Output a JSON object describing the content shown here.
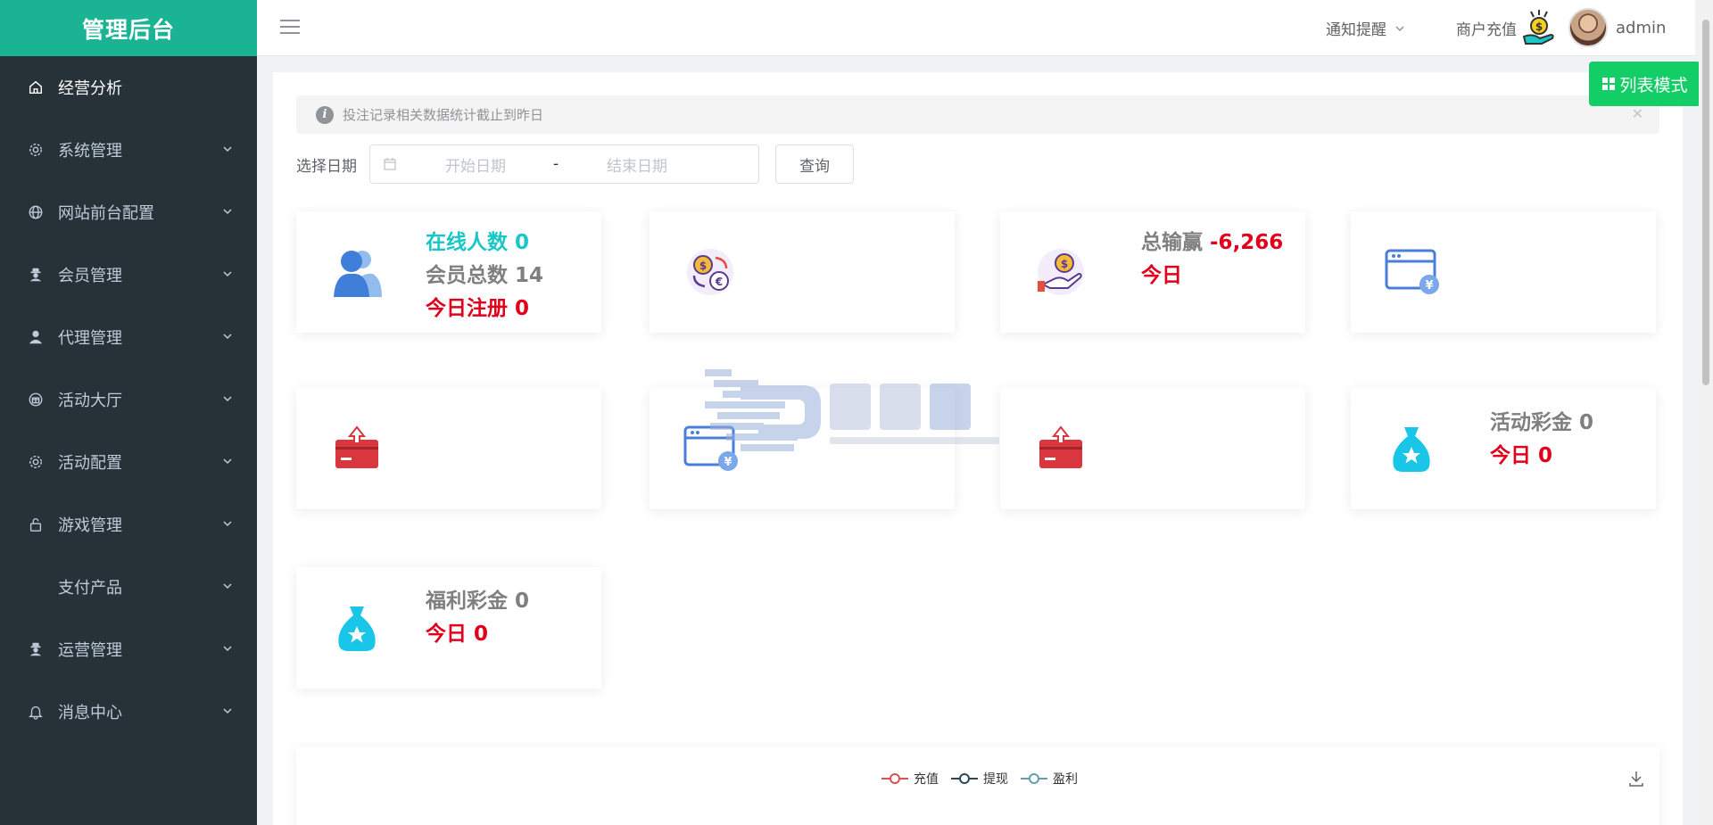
{
  "sidebar": {
    "brand": "管理后台",
    "items": [
      {
        "label": "经营分析",
        "icon": "home-icon",
        "active": true
      },
      {
        "label": "系统管理",
        "icon": "gear-icon"
      },
      {
        "label": "网站前台配置",
        "icon": "globe-icon"
      },
      {
        "label": "会员管理",
        "icon": "user-secret-icon"
      },
      {
        "label": "代理管理",
        "icon": "user-icon"
      },
      {
        "label": "活动大厅",
        "icon": "gift-icon"
      },
      {
        "label": "活动配置",
        "icon": "gear-icon"
      },
      {
        "label": "游戏管理",
        "icon": "lock-icon"
      },
      {
        "label": "支付产品",
        "icon": ""
      },
      {
        "label": "运营管理",
        "icon": "user-secret-icon"
      },
      {
        "label": "消息中心",
        "icon": "bell-icon"
      }
    ]
  },
  "header": {
    "notice": "通知提醒",
    "recharge": "商户充值",
    "username": "admin"
  },
  "main": {
    "list_mode": "列表模式",
    "alert": "投注记录相关数据统计截止到昨日",
    "date_label": "选择日期",
    "start_placeholder": "开始日期",
    "range_sep": "-",
    "end_placeholder": "结束日期",
    "query": "查询"
  },
  "cards": {
    "online": "在线人数 0",
    "members": "会员总数 14",
    "today_reg": "今日注册 0",
    "total_win_label": "总输赢",
    "total_win_value": "-6,266",
    "total_win_today": "今日",
    "activity_bonus": "活动彩金 0",
    "activity_today": "今日 0",
    "welfare_bonus": "福利彩金 0",
    "welfare_today": "今日 0"
  },
  "chart": {
    "legend": [
      {
        "name": "充值",
        "color": "#d9534f"
      },
      {
        "name": "提现",
        "color": "#2f4554"
      },
      {
        "name": "盈利",
        "color": "#61a0a8"
      }
    ]
  },
  "colors": {
    "brand": "#1ab394",
    "sidebar": "#263238",
    "accent_green": "#13ce66",
    "red": "#e0001b",
    "teal": "#1ac6c6"
  }
}
